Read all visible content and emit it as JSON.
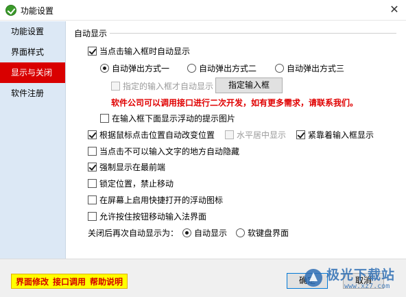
{
  "window": {
    "title": "功能设置",
    "close_glyph": "✕"
  },
  "sidebar": {
    "items": [
      {
        "label": "功能设置"
      },
      {
        "label": "界面样式"
      },
      {
        "label": "显示与关闭",
        "active": true
      },
      {
        "label": "软件注册"
      }
    ]
  },
  "main": {
    "group_title": "自动显示",
    "auto_show_on_click": {
      "label": "当点击输入框时自动显示",
      "checked": true
    },
    "popup_modes": {
      "options": [
        {
          "label": "自动弹出方式一",
          "selected": true
        },
        {
          "label": "自动弹出方式二",
          "selected": false
        },
        {
          "label": "自动弹出方式三",
          "selected": false
        }
      ]
    },
    "specified_only": {
      "label": "指定的输入框才自动显示",
      "checked": false,
      "disabled": true
    },
    "specify_button": "指定输入框",
    "notice": "软件公司可以调用接口进行二次开发，如有更多需求，请联系我们。",
    "show_floating_image": {
      "label": "在输入框下面显示浮动的提示图片",
      "checked": false
    },
    "change_position_by_click": {
      "label": "根据鼠标点击位置自动改变位置",
      "checked": true
    },
    "horizontal_center": {
      "label": "水平居中显示",
      "checked": false,
      "disabled": true
    },
    "stick_to_input": {
      "label": "紧靠着输入框显示",
      "checked": true
    },
    "auto_hide_non_text": {
      "label": "当点击不可以输入文字的地方自动隐藏",
      "checked": false
    },
    "always_on_top": {
      "label": "强制显示在最前端",
      "checked": true
    },
    "lock_position": {
      "label": "锁定位置，禁止移动",
      "checked": false
    },
    "quick_open_icon": {
      "label": "在屏幕上启用快捷打开的浮动图标",
      "checked": false
    },
    "allow_drag_move": {
      "label": "允许按住按钮移动输入法界面",
      "checked": false
    },
    "reopen_label": "关闭后再次自动显示为：",
    "reopen_options": [
      {
        "label": "自动显示",
        "selected": true
      },
      {
        "label": "软键盘界面",
        "selected": false
      }
    ]
  },
  "footer": {
    "links": [
      "界面修改",
      "接口调用",
      "帮助说明"
    ],
    "ok_button": "确定",
    "cancel_button": "取消",
    "watermark_text": "极光下载站",
    "watermark_url": "www.xz7.com"
  }
}
